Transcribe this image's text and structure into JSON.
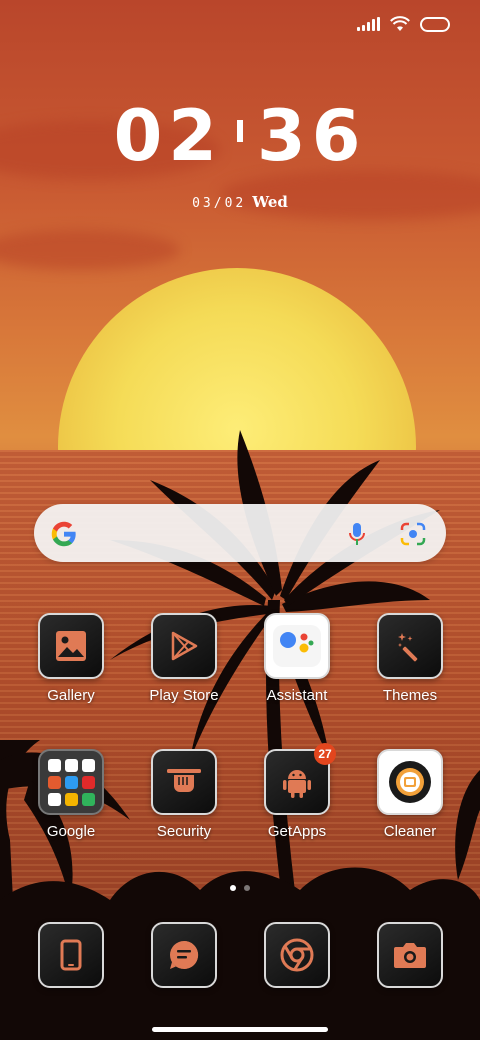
{
  "status_bar": {
    "icons": [
      "signal-icon",
      "wifi-icon",
      "battery-icon"
    ]
  },
  "clock": {
    "hours": "02",
    "minutes": "36"
  },
  "date": {
    "day": "03/02",
    "weekday": "Wed"
  },
  "search": {
    "icons": [
      "google-g-icon",
      "microphone-icon",
      "google-lens-icon"
    ]
  },
  "apps": [
    {
      "label": "Gallery",
      "icon": "gallery-icon"
    },
    {
      "label": "Play Store",
      "icon": "play-store-icon"
    },
    {
      "label": "Assistant",
      "icon": "assistant-icon"
    },
    {
      "label": "Themes",
      "icon": "magic-wand-icon"
    },
    {
      "label": "Google",
      "icon": "folder-icon"
    },
    {
      "label": "Security",
      "icon": "security-hand-icon"
    },
    {
      "label": "GetApps",
      "icon": "android-icon",
      "badge": "27"
    },
    {
      "label": "Cleaner",
      "icon": "cleaner-icon"
    }
  ],
  "dock": [
    {
      "icon": "phone-icon"
    },
    {
      "icon": "messages-icon"
    },
    {
      "icon": "chrome-icon"
    },
    {
      "icon": "camera-icon"
    }
  ],
  "page_indicator": {
    "pages": 2,
    "current": 1
  },
  "colors": {
    "accent": "#e07a55",
    "badge": "#e2461e"
  }
}
